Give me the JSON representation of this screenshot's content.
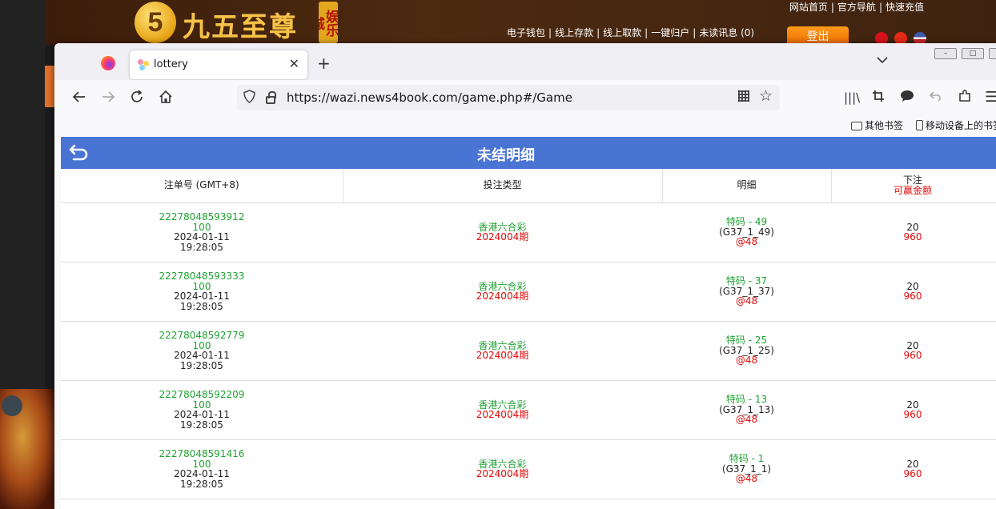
{
  "site": {
    "logo_mark": "5",
    "logo_text": "九五至尊",
    "logo_tag": "娱乐城",
    "top_links": [
      "网站首页",
      "官方导航",
      "快速充值"
    ],
    "mid_links": [
      "电子钱包",
      "线上存款",
      "线上取款",
      "一键归户",
      "未读讯息 (0)"
    ],
    "login_label": "登出"
  },
  "browser": {
    "tab_title": "lottery",
    "url": "https://wazi.news4book.com/game.php#/Game",
    "bookmarks": [
      "其他书签",
      "移动设备上的书签"
    ],
    "win_buttons": [
      "–",
      "□",
      "×"
    ]
  },
  "page": {
    "title": "未结明细",
    "columns": {
      "order_no": "注单号 (GMT+8)",
      "bet_type": "投注类型",
      "detail": "明细",
      "stake_line1": "下注",
      "stake_line2": "可赢金额"
    },
    "rows": [
      {
        "order": "22278048593912",
        "amount": "100",
        "date": "2024-01-11",
        "time": "19:28:05",
        "game": "香港六合彩",
        "period": "2024004期",
        "pick": "特码 - 49",
        "code": "(G37_1_49)",
        "odds": "@48",
        "stake": "20",
        "win": "960"
      },
      {
        "order": "22278048593333",
        "amount": "100",
        "date": "2024-01-11",
        "time": "19:28:05",
        "game": "香港六合彩",
        "period": "2024004期",
        "pick": "特码 - 37",
        "code": "(G37_1_37)",
        "odds": "@48",
        "stake": "20",
        "win": "960"
      },
      {
        "order": "22278048592779",
        "amount": "100",
        "date": "2024-01-11",
        "time": "19:28:05",
        "game": "香港六合彩",
        "period": "2024004期",
        "pick": "特码 - 25",
        "code": "(G37_1_25)",
        "odds": "@48",
        "stake": "20",
        "win": "960"
      },
      {
        "order": "22278048592209",
        "amount": "100",
        "date": "2024-01-11",
        "time": "19:28:05",
        "game": "香港六合彩",
        "period": "2024004期",
        "pick": "特码 - 13",
        "code": "(G37_1_13)",
        "odds": "@48",
        "stake": "20",
        "win": "960"
      },
      {
        "order": "22278048591416",
        "amount": "100",
        "date": "2024-01-11",
        "time": "19:28:05",
        "game": "香港六合彩",
        "period": "2024004期",
        "pick": "特码 - 1",
        "code": "(G37_1_1)",
        "odds": "@48",
        "stake": "20",
        "win": "960"
      }
    ]
  },
  "colors": {
    "header_blue": "#4a74d3",
    "text_green": "#1fa133",
    "text_red": "#e00b0b"
  }
}
